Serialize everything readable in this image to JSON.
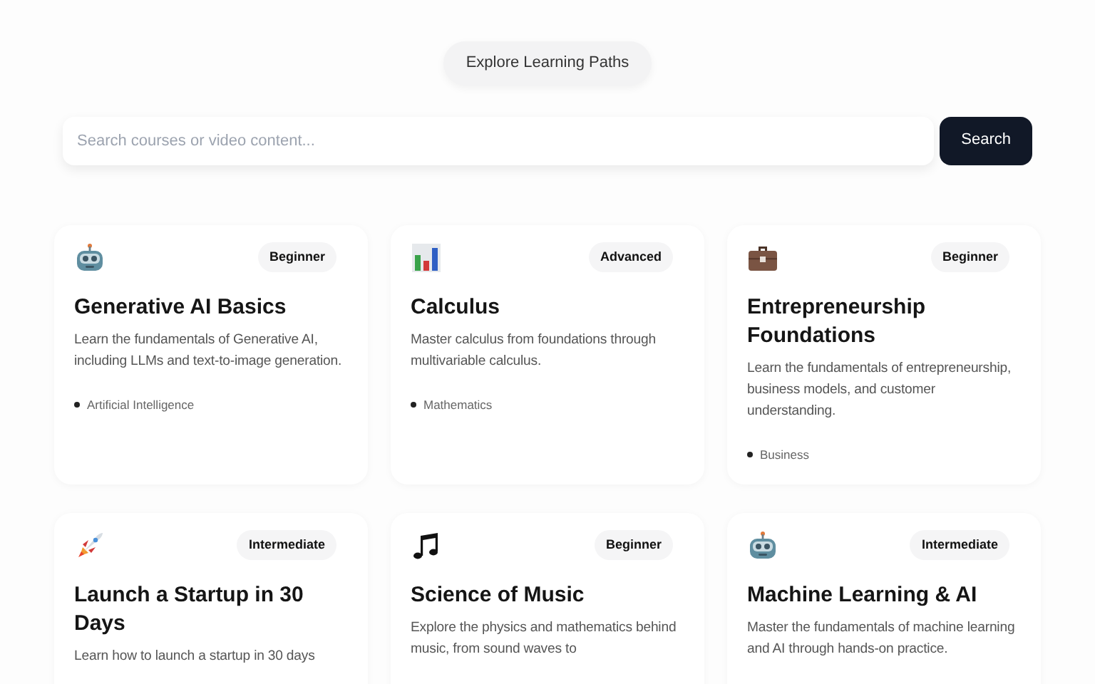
{
  "header": {
    "label": "Explore Learning Paths"
  },
  "search": {
    "placeholder": "Search courses or video content...",
    "button": "Search"
  },
  "courses": [
    {
      "kind": "robot",
      "level": "Beginner",
      "title": "Generative AI Basics",
      "description": "Learn the fundamentals of Generative AI, including LLMs and text-to-image generation.",
      "category": "Artificial Intelligence"
    },
    {
      "kind": "chart",
      "level": "Advanced",
      "title": "Calculus",
      "description": "Master calculus from foundations through multivariable calculus.",
      "category": "Mathematics"
    },
    {
      "kind": "briefcase",
      "level": "Beginner",
      "title": "Entrepreneurship Foundations",
      "description": "Learn the fundamentals of entrepreneurship, business models, and customer understanding.",
      "category": "Business"
    },
    {
      "kind": "rocket",
      "level": "Intermediate",
      "title": "Launch a Startup in 30 Days",
      "description": "Learn how to launch a startup in 30 days"
    },
    {
      "kind": "music",
      "level": "Beginner",
      "title": "Science of Music",
      "description": "Explore the physics and mathematics behind music, from sound waves to"
    },
    {
      "kind": "robot",
      "level": "Intermediate",
      "title": "Machine Learning & AI",
      "description": "Master the fundamentals of machine learning and AI through hands-on practice."
    }
  ]
}
